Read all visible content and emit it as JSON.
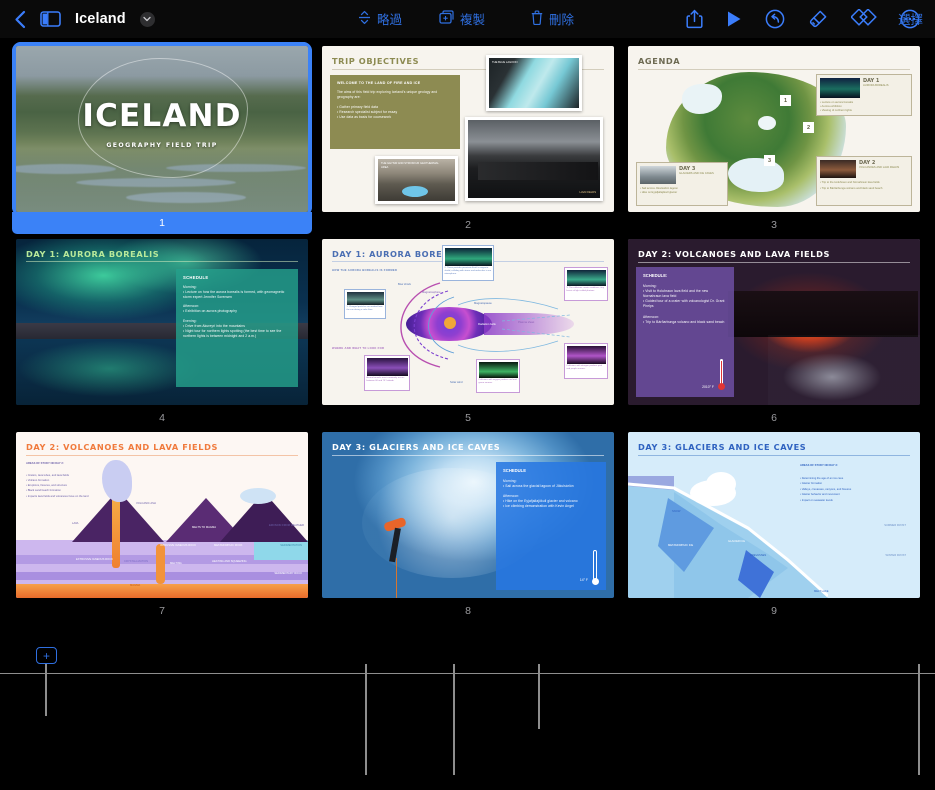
{
  "app": {
    "document_title": "Iceland",
    "back_icon": "chevron-left-icon",
    "sidebar_icon": "sidebar-toggle-icon",
    "title_menu_icon": "chevron-down-icon"
  },
  "toolbar": {
    "items": [
      {
        "name": "share-button",
        "icon": "share-icon",
        "label": ""
      },
      {
        "name": "play-button",
        "icon": "play-icon",
        "label": ""
      },
      {
        "name": "undo-button",
        "icon": "undo-icon",
        "label": ""
      },
      {
        "name": "format-button",
        "icon": "paintbrush-icon",
        "label": ""
      },
      {
        "name": "transition-button",
        "icon": "diamonds-icon",
        "label": ""
      },
      {
        "name": "more-button",
        "icon": "ellipsis-circle-icon",
        "label": ""
      }
    ]
  },
  "bottom_toolbar": {
    "add_label": "+",
    "skip_label": "略過",
    "duplicate_label": "複製",
    "delete_label": "刪除",
    "select_label": "選擇",
    "skip_icon": "skip-slide-icon",
    "duplicate_icon": "duplicate-icon",
    "delete_icon": "trash-icon"
  },
  "colors": {
    "accent_blue": "#3b82f7",
    "toolbar_blue": "#2f6fe0",
    "background": "#000000",
    "guide_line": "#8e8e8e"
  },
  "slides": [
    {
      "number": "1",
      "selected": true,
      "title": "ICELAND",
      "subtitle": "GEOGRAPHY FIELD TRIP",
      "kind": "title-photo"
    },
    {
      "number": "2",
      "selected": false,
      "title": "TRIP OBJECTIVES",
      "kind": "objectives",
      "box_heading": "WELCOME TO THE LAND OF FIRE AND ICE",
      "box_body": "The aims of this field trip exploring Iceland's unique geology and geography are:",
      "bullets": [
        "Gather primary field data",
        "Research specialist subject for essay",
        "Use data as basis for coursework"
      ],
      "photo_captions": [
        "THE BLUE LAGOON",
        "THE GEYSIR AND STROKKUR GEOTHERMAL AREA",
        "LAVA FIELDS"
      ]
    },
    {
      "number": "3",
      "selected": false,
      "title": "AGENDA",
      "kind": "agenda-map",
      "map_pins": [
        "1",
        "2",
        "3"
      ],
      "cards": [
        {
          "day": "DAY 1",
          "subtitle": "AURORA BOREALIS",
          "bullets": [
            "Lecture on aurora borealis",
            "Aurora exhibition",
            "Viewing of northern lights"
          ]
        },
        {
          "day": "DAY 2",
          "subtitle": "VOLCANOES AND LAVA FIELDS",
          "bullets": [
            "Trip to the Holuhraun and Nornahraun lava fields",
            "Trip to Bárðarbunga volcano and black sand beach"
          ]
        },
        {
          "day": "DAY 3",
          "subtitle": "GLACIERS AND ICE CAVES",
          "bullets": [
            "Sail across Jökulsárlón lagoon",
            "Hike on Eyjafjallajökull glacier"
          ]
        }
      ]
    },
    {
      "number": "4",
      "selected": false,
      "title": "DAY 1: AURORA BOREALIS",
      "kind": "day-schedule-photo",
      "schedule_heading": "SCHEDULE",
      "sections": [
        {
          "label": "Morning:",
          "items": [
            "Lecture on how the aurora borealis is formed, with geomagnetic storm expert Jennifer Sorensen"
          ]
        },
        {
          "label": "Afternoon:",
          "items": [
            "Exhibition on aurora photography"
          ]
        },
        {
          "label": "Evening:",
          "items": [
            "Drive from Akureyri into the mountains",
            "Night tour for northern lights spotting (the best time to see the northern lights is between midnight and 2 a.m.)"
          ]
        }
      ]
    },
    {
      "number": "5",
      "selected": false,
      "title": "DAY 1: AURORA BOREALIS",
      "kind": "diagram-magnetosphere",
      "section_labels": [
        "HOW THE AURORA BOREALIS IS FORMED",
        "WHERE AND WHAT TO LOOK FOR"
      ],
      "diagram_labels": [
        "Bow shock",
        "Magnetosphere",
        "Magnetopause",
        "Plasma sheet",
        "Radiation belts",
        "Solar wind",
        "Auroral ovals"
      ],
      "callouts": [
        "1. Charged particles are emitted from the sun during a solar flare.",
        "2. These particles penetrate Earth's magnetic shield, colliding with atoms and molecules in our atmosphere.",
        "3. The collisions create conditions, tiny bursts of light called photons.",
        "Aurora borealis most commonly occurs between 60 and 75° latitude.",
        "Collisions with oxygen produce red and green auroras.",
        "Collisions with nitrogen produce pink and purple auroras."
      ]
    },
    {
      "number": "6",
      "selected": false,
      "title": "DAY 2: VOLCANOES AND LAVA FIELDS",
      "kind": "day-schedule-photo",
      "schedule_heading": "SCHEDULE:",
      "temperature": "2010° F",
      "sections": [
        {
          "label": "Morning:",
          "items": [
            "Visit to Holuhraun lava field and the new Nornahraun lava field",
            "Guided tour of a crater with volcanologist Dr. Grant Phelps"
          ]
        },
        {
          "label": "Afternoon:",
          "items": [
            "Trip to Bárðarbunga volcano and black sand beach"
          ]
        }
      ]
    },
    {
      "number": "7",
      "selected": false,
      "title": "DAY 2: VOLCANOES AND LAVA FIELDS",
      "kind": "diagram-volcano",
      "areas_heading": "AREAS OF STUDY ON DAY 2:",
      "bullets": [
        "Craters, lava tubes, and lava fields",
        "Volcano formation",
        "Eruptions, fissures, and structure",
        "Black sand beach formation",
        "Impacts lava fields and volcanoes have on the land"
      ],
      "diagram_labels": [
        "VOLCANIC ASH",
        "LAVA",
        "MELTS TO MAGMA",
        "EROSION FROM WEATHER",
        "INTRUSIVE IGNEOUS ROCK",
        "METAMORPHIC ROCK",
        "SEDIMENTATION",
        "EXTRUSIVE IGNEOUS ROCK",
        "CRYSTALLIZATION",
        "MELTING",
        "HEATING AND SQUEEZING",
        "SEDIMENTARY ROCK",
        "MAGMA"
      ]
    },
    {
      "number": "8",
      "selected": false,
      "title": "DAY 3: GLACIERS AND ICE CAVES",
      "kind": "day-schedule-photo",
      "schedule_heading": "SCHEDULE",
      "temperature": "14° F",
      "sections": [
        {
          "label": "Morning:",
          "items": [
            "Sail across the glacial lagoon of Jökulsárlón"
          ]
        },
        {
          "label": "Afternoon:",
          "items": [
            "Hike on the Eyjafjallajökull glacier and volcano",
            "Ice climbing demonstration with Kevin Angel"
          ]
        }
      ]
    },
    {
      "number": "9",
      "selected": false,
      "title": "DAY 3: GLACIERS AND ICE CAVES",
      "kind": "diagram-glacier",
      "areas_heading": "AREAS OF STUDY ON DAY 3:",
      "bullets": [
        "Determining the age of an ice cave",
        "Glacier formation",
        "Valleys, crevasses, canyons, and fissures",
        "Glacier behavior and movement",
        "Impact on seawater levels"
      ],
      "diagram_labels": [
        "SNOW",
        "METAMORPHIC ICE",
        "GLACIER ICE",
        "CREVASSES",
        "SUMMER FROST",
        "WINTER FROST",
        "MELT LAKE"
      ]
    }
  ]
}
